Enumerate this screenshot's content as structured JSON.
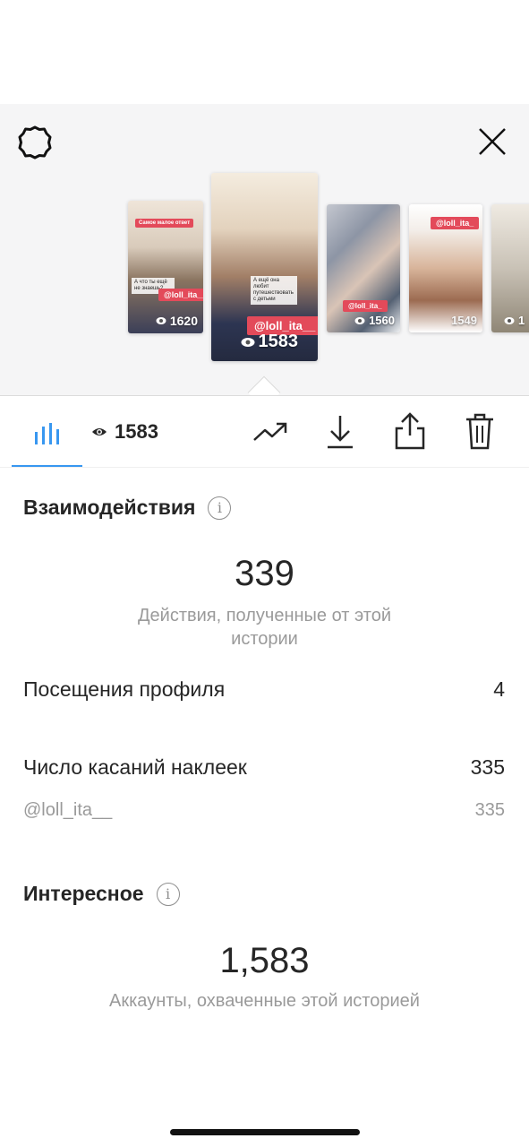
{
  "tray": {
    "thumbnails": [
      {
        "views": "1620",
        "tag": "@loll_ita__",
        "caption": "А что ты ещё не знаешь?"
      },
      {
        "views": "1583",
        "tag": "@loll_ita__",
        "caption": "А ещё она любит путешествовать с детьми"
      },
      {
        "views": "1560",
        "tag": "@loll_ita_",
        "caption": ""
      },
      {
        "views": "1549",
        "tag": "@loll_ita_",
        "caption": ""
      },
      {
        "views": "1",
        "tag": "",
        "caption": ""
      }
    ]
  },
  "toolbar": {
    "view_count": "1583"
  },
  "interactions": {
    "title": "Взаимодействия",
    "total": "339",
    "total_caption": "Действия, полученные от этой истории",
    "rows": [
      {
        "label": "Посещения профиля",
        "value": "4"
      },
      {
        "label": "Число касаний наклеек",
        "value": "335"
      }
    ],
    "sub_row": {
      "label": "@loll_ita__",
      "value": "335"
    }
  },
  "discovery": {
    "title": "Интересное",
    "total": "1,583",
    "total_caption": "Аккаунты, охваченные этой историей"
  },
  "colors": {
    "accent": "#3897f0",
    "tag": "#e34a5a"
  }
}
